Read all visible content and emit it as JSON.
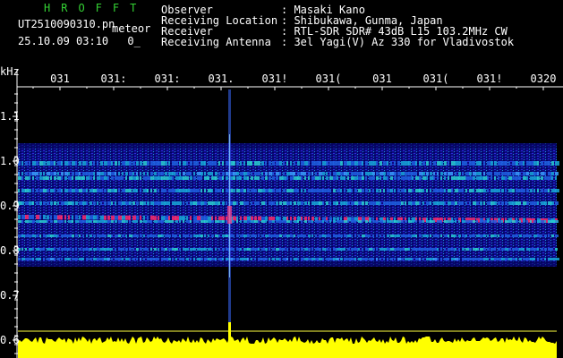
{
  "header": {
    "title": "HROFFT",
    "filename": "UT2510090310.pn",
    "meteor_label": "meteor",
    "datetime": "25.10.09 03:10",
    "status": "0_",
    "info": [
      {
        "label": "Observer",
        "value": ": Masaki Kano"
      },
      {
        "label": "Receiving Location",
        "value": ": Shibukawa, Gunma, Japan"
      },
      {
        "label": "Receiver",
        "value": ": RTL-SDR SDR# 43dB L15 103.2MHz CW"
      },
      {
        "label": "Receiving Antenna",
        "value": ": 3el Yagi(V) Az 330 for Vladivostok"
      }
    ]
  },
  "colors": {
    "title": "#34d134",
    "spectrum_bg": "#0a0a8c",
    "strong_signal": "#ff2a6a",
    "mid_signal": "#2ad0d0",
    "power_trace": "#ffff00",
    "axis": "#ffffff"
  },
  "axes": {
    "y_unit": "kHz",
    "y_ticks": [
      "1.1",
      "1.0",
      "0.9",
      "0.8",
      "0.7",
      "0.6"
    ],
    "x_ticks": [
      "031",
      "031:",
      "031:",
      "031.",
      "031!",
      "031(",
      "031",
      "031(",
      "031!",
      "0320"
    ]
  }
}
